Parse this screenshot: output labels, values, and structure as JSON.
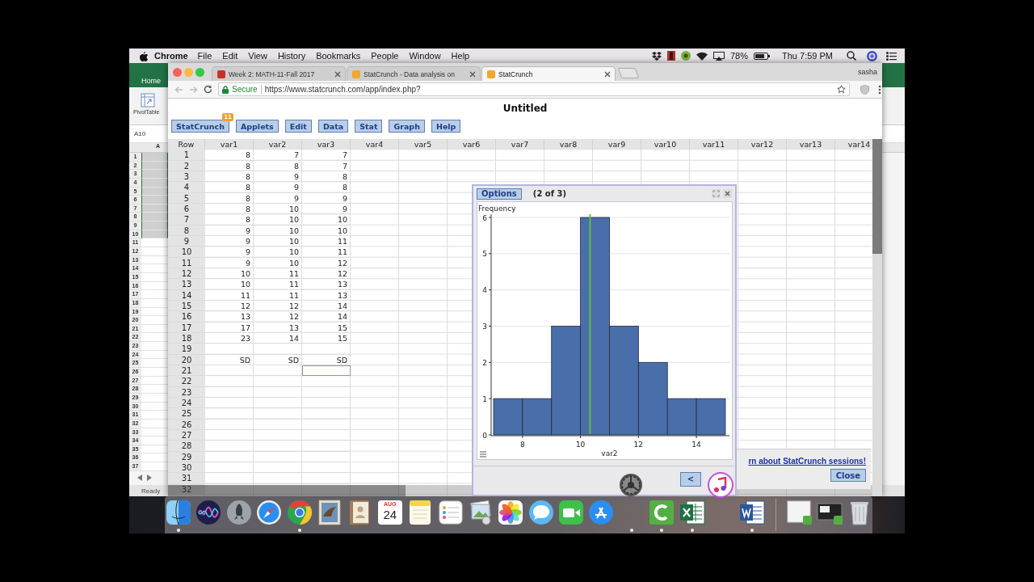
{
  "menubar": {
    "app": "Chrome",
    "menus": [
      "File",
      "Edit",
      "View",
      "History",
      "Bookmarks",
      "People",
      "Window",
      "Help"
    ],
    "battery": "78%",
    "clock": "Thu 7:59 PM"
  },
  "excel": {
    "ribbon_tab": "Home",
    "ribbon_button": "PivotTable",
    "name_box": "A10",
    "column": "A",
    "status": "Ready",
    "rows": [
      {
        "label": "1",
        "selected": true
      },
      {
        "label": "2",
        "selected": true
      },
      {
        "label": "3",
        "selected": true
      },
      {
        "label": "4",
        "selected": true
      },
      {
        "label": "5",
        "selected": true
      },
      {
        "label": "6",
        "selected": true
      },
      {
        "label": "7",
        "selected": true
      },
      {
        "label": "8",
        "selected": true
      },
      {
        "label": "9",
        "selected": true
      },
      {
        "label": "10",
        "selected": true
      },
      {
        "label": "11",
        "selected": false
      },
      {
        "label": "12",
        "selected": false
      },
      {
        "label": "13",
        "selected": false
      },
      {
        "label": "14",
        "selected": false
      },
      {
        "label": "15",
        "selected": false
      },
      {
        "label": "16",
        "selected": false
      },
      {
        "label": "17",
        "selected": false
      },
      {
        "label": "18",
        "selected": false
      },
      {
        "label": "19",
        "selected": false
      },
      {
        "label": "20",
        "selected": false
      },
      {
        "label": "21",
        "selected": false
      },
      {
        "label": "22",
        "selected": false
      },
      {
        "label": "23",
        "selected": false
      },
      {
        "label": "24",
        "selected": false
      },
      {
        "label": "25",
        "selected": false
      },
      {
        "label": "26",
        "selected": false
      },
      {
        "label": "27",
        "selected": false
      },
      {
        "label": "28",
        "selected": false
      },
      {
        "label": "29",
        "selected": false
      },
      {
        "label": "30",
        "selected": false
      },
      {
        "label": "31",
        "selected": false
      },
      {
        "label": "32",
        "selected": false
      },
      {
        "label": "33",
        "selected": false
      },
      {
        "label": "34",
        "selected": false
      },
      {
        "label": "35",
        "selected": false
      },
      {
        "label": "36",
        "selected": false
      },
      {
        "label": "37",
        "selected": false
      }
    ]
  },
  "browser": {
    "tabs": [
      {
        "title": "Week 2: MATH-11-Fall 2017",
        "selected": false,
        "color": "#c8312b"
      },
      {
        "title": "StatCrunch - Data analysis on",
        "selected": false,
        "color": "#f0a830"
      },
      {
        "title": "StatCrunch",
        "selected": true,
        "color": "#f0a830"
      }
    ],
    "profile": "sasha",
    "security": "Secure",
    "url": "https://www.statcrunch.com/app/index.php?"
  },
  "page": {
    "title": "Untitled",
    "menu": [
      {
        "label": "StatCrunch",
        "badge": "11"
      },
      {
        "label": "Applets"
      },
      {
        "label": "Edit"
      },
      {
        "label": "Data"
      },
      {
        "label": "Stat"
      },
      {
        "label": "Graph"
      },
      {
        "label": "Help"
      }
    ]
  },
  "grid": {
    "columns": [
      "Row",
      "var1",
      "var2",
      "var3",
      "var4",
      "var5",
      "var6",
      "var7",
      "var8",
      "var9",
      "var10",
      "var11",
      "var12",
      "var13",
      "var14"
    ],
    "rows": [
      {
        "row": "1",
        "cells": [
          {
            "value": "8",
            "selected": false
          },
          {
            "value": "7",
            "selected": false
          },
          {
            "value": "7",
            "selected": false
          }
        ]
      },
      {
        "row": "2",
        "cells": [
          {
            "value": "8",
            "selected": false
          },
          {
            "value": "8",
            "selected": false
          },
          {
            "value": "7",
            "selected": false
          }
        ]
      },
      {
        "row": "3",
        "cells": [
          {
            "value": "8",
            "selected": false
          },
          {
            "value": "9",
            "selected": false
          },
          {
            "value": "8",
            "selected": false
          }
        ]
      },
      {
        "row": "4",
        "cells": [
          {
            "value": "8",
            "selected": false
          },
          {
            "value": "9",
            "selected": false
          },
          {
            "value": "8",
            "selected": false
          }
        ]
      },
      {
        "row": "5",
        "cells": [
          {
            "value": "8",
            "selected": false
          },
          {
            "value": "9",
            "selected": false
          },
          {
            "value": "9",
            "selected": false
          }
        ]
      },
      {
        "row": "6",
        "cells": [
          {
            "value": "8",
            "selected": false
          },
          {
            "value": "10",
            "selected": false
          },
          {
            "value": "9",
            "selected": false
          }
        ]
      },
      {
        "row": "7",
        "cells": [
          {
            "value": "8",
            "selected": false
          },
          {
            "value": "10",
            "selected": false
          },
          {
            "value": "10",
            "selected": false
          }
        ]
      },
      {
        "row": "8",
        "cells": [
          {
            "value": "9",
            "selected": false
          },
          {
            "value": "10",
            "selected": false
          },
          {
            "value": "10",
            "selected": false
          }
        ]
      },
      {
        "row": "9",
        "cells": [
          {
            "value": "9",
            "selected": false
          },
          {
            "value": "10",
            "selected": false
          },
          {
            "value": "11",
            "selected": false
          }
        ]
      },
      {
        "row": "10",
        "cells": [
          {
            "value": "9",
            "selected": false
          },
          {
            "value": "10",
            "selected": false
          },
          {
            "value": "11",
            "selected": false
          }
        ]
      },
      {
        "row": "11",
        "cells": [
          {
            "value": "9",
            "selected": false
          },
          {
            "value": "10",
            "selected": false
          },
          {
            "value": "12",
            "selected": false
          }
        ]
      },
      {
        "row": "12",
        "cells": [
          {
            "value": "10",
            "selected": false
          },
          {
            "value": "11",
            "selected": false
          },
          {
            "value": "12",
            "selected": false
          }
        ]
      },
      {
        "row": "13",
        "cells": [
          {
            "value": "10",
            "selected": false
          },
          {
            "value": "11",
            "selected": false
          },
          {
            "value": "13",
            "selected": false
          }
        ]
      },
      {
        "row": "14",
        "cells": [
          {
            "value": "11",
            "selected": false
          },
          {
            "value": "11",
            "selected": false
          },
          {
            "value": "13",
            "selected": false
          }
        ]
      },
      {
        "row": "15",
        "cells": [
          {
            "value": "12",
            "selected": false
          },
          {
            "value": "12",
            "selected": false
          },
          {
            "value": "14",
            "selected": false
          }
        ]
      },
      {
        "row": "16",
        "cells": [
          {
            "value": "13",
            "selected": false
          },
          {
            "value": "12",
            "selected": false
          },
          {
            "value": "14",
            "selected": false
          }
        ]
      },
      {
        "row": "17",
        "cells": [
          {
            "value": "17",
            "selected": false
          },
          {
            "value": "13",
            "selected": false
          },
          {
            "value": "15",
            "selected": false
          }
        ]
      },
      {
        "row": "18",
        "cells": [
          {
            "value": "23",
            "selected": false
          },
          {
            "value": "14",
            "selected": false
          },
          {
            "value": "15",
            "selected": false
          }
        ]
      },
      {
        "row": "19",
        "cells": [
          {
            "selected": false
          },
          {
            "selected": false
          },
          {
            "selected": false
          }
        ]
      },
      {
        "row": "20",
        "cells": [
          {
            "value": "SD",
            "selected": false
          },
          {
            "value": "SD",
            "selected": false
          },
          {
            "value": "SD",
            "selected": false
          }
        ]
      },
      {
        "row": "21",
        "cells": [
          {
            "selected": false
          },
          {
            "selected": false
          },
          {
            "selected": true
          }
        ]
      },
      {
        "row": "22",
        "cells": [
          {
            "selected": false
          },
          {
            "selected": false
          },
          {
            "selected": false
          }
        ]
      },
      {
        "row": "23",
        "cells": [
          {
            "selected": false
          },
          {
            "selected": false
          },
          {
            "selected": false
          }
        ]
      },
      {
        "row": "24",
        "cells": [
          {
            "selected": false
          },
          {
            "selected": false
          },
          {
            "selected": false
          }
        ]
      },
      {
        "row": "25",
        "cells": [
          {
            "selected": false
          },
          {
            "selected": false
          },
          {
            "selected": false
          }
        ]
      },
      {
        "row": "26",
        "cells": [
          {
            "selected": false
          },
          {
            "selected": false
          },
          {
            "selected": false
          }
        ]
      },
      {
        "row": "27",
        "cells": [
          {
            "selected": false
          },
          {
            "selected": false
          },
          {
            "selected": false
          }
        ]
      },
      {
        "row": "28",
        "cells": [
          {
            "selected": false
          },
          {
            "selected": false
          },
          {
            "selected": false
          }
        ]
      },
      {
        "row": "29",
        "cells": [
          {
            "selected": false
          },
          {
            "selected": false
          },
          {
            "selected": false
          }
        ]
      },
      {
        "row": "30",
        "cells": [
          {
            "selected": false
          },
          {
            "selected": false
          },
          {
            "selected": false
          }
        ]
      },
      {
        "row": "31",
        "cells": [
          {
            "selected": false
          },
          {
            "selected": false
          },
          {
            "selected": false
          }
        ]
      },
      {
        "row": "32"
      }
    ]
  },
  "graph_window": {
    "options": "Options",
    "counter": "(2 of 3)",
    "prev": "<",
    "chart_data": {
      "type": "bar",
      "xlabel": "var2",
      "ylabel": "Frequency",
      "x": [
        7.5,
        8.5,
        9.5,
        10.5,
        11.5,
        12.5,
        13.5,
        14.5
      ],
      "values": [
        1,
        1,
        3,
        6,
        3,
        2,
        1,
        1
      ],
      "grid": true,
      "xlim": [
        7,
        15
      ],
      "ylim": [
        0,
        6
      ],
      "xticks": [
        8,
        10,
        12,
        14
      ],
      "yticks": [
        0,
        1,
        2,
        3,
        4,
        5,
        6
      ],
      "ref_lines": [
        {
          "axis": "x",
          "value": 10.33,
          "color": "#5cc13c"
        }
      ]
    }
  },
  "session_dialog": {
    "link": "rn about StatCrunch sessions!",
    "close": "Close"
  },
  "dock": {
    "items": [
      {
        "kind": "finder",
        "running": true
      },
      {
        "kind": "siri",
        "running": false
      },
      {
        "kind": "launchpad",
        "running": false
      },
      {
        "kind": "safari",
        "running": false
      },
      {
        "kind": "chrome",
        "running": true
      },
      {
        "kind": "mail",
        "running": false
      },
      {
        "kind": "contacts",
        "running": false
      },
      {
        "kind": "calendar",
        "running": false,
        "month": "AUG",
        "day": "24"
      },
      {
        "kind": "notes",
        "running": false
      },
      {
        "kind": "reminders",
        "running": false
      },
      {
        "kind": "preview",
        "running": false
      },
      {
        "kind": "photos",
        "running": false
      },
      {
        "kind": "messages",
        "running": false
      },
      {
        "kind": "facetime",
        "running": false
      },
      {
        "kind": "appstore",
        "running": false
      },
      {
        "kind": "space",
        "running": true
      },
      {
        "kind": "camtasia",
        "running": true
      },
      {
        "kind": "excel",
        "running": true
      },
      {
        "kind": "space",
        "running": false
      },
      {
        "kind": "word",
        "running": true
      },
      {
        "kind": "separator"
      },
      {
        "kind": "file",
        "running": false
      },
      {
        "kind": "screenshot",
        "running": false
      },
      {
        "kind": "trash",
        "running": false
      }
    ]
  }
}
